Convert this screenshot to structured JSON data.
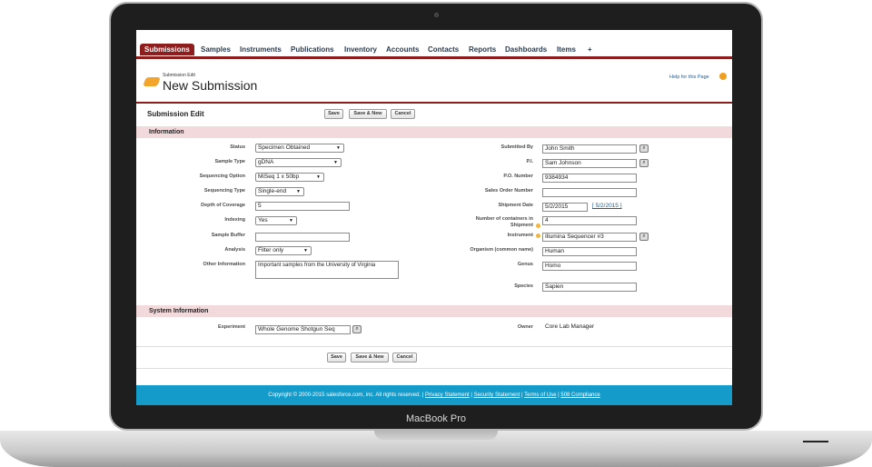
{
  "device": {
    "brand": "MacBook Pro"
  },
  "tabs": [
    "Submissions",
    "Samples",
    "Instruments",
    "Publications",
    "Inventory",
    "Accounts",
    "Contacts",
    "Reports",
    "Dashboards",
    "Items",
    "+"
  ],
  "header": {
    "subtitle": "Submission Edit",
    "title": "New Submission",
    "help": "Help for this Page"
  },
  "edit_title": "Submission Edit",
  "buttons": {
    "save": "Save",
    "save_new": "Save & New",
    "cancel": "Cancel"
  },
  "sections": {
    "information": "Information",
    "system": "System Information"
  },
  "left_fields": {
    "status": {
      "label": "Status",
      "value": "Specimen Obtained"
    },
    "sample_type": {
      "label": "Sample Type",
      "value": "gDNA"
    },
    "sequencing_option": {
      "label": "Sequencing Option",
      "value": "MiSeq 1 x 50bp"
    },
    "sequencing_type": {
      "label": "Sequencing Type",
      "value": "Single-end"
    },
    "depth": {
      "label": "Depth of Coverage",
      "value": "5"
    },
    "indexing": {
      "label": "Indexing",
      "value": "Yes"
    },
    "buffer": {
      "label": "Sample Buffer",
      "value": ""
    },
    "analysis": {
      "label": "Analysis",
      "value": "Filter only"
    },
    "other": {
      "label": "Other Information",
      "value": "Important samples from the University of Virginia"
    }
  },
  "right_fields": {
    "submitted_by": {
      "label": "Submitted By",
      "value": "John Smith"
    },
    "pi": {
      "label": "P.I.",
      "value": "Sam Johnson"
    },
    "po": {
      "label": "P.O. Number",
      "value": "9384934"
    },
    "so": {
      "label": "Sales Order Number",
      "value": ""
    },
    "ship_date": {
      "label": "Shipment Date",
      "value": "5/2/2015",
      "link": "[ 5/2/2015 ]"
    },
    "containers": {
      "label1": "Number of containers in",
      "label2": "Shipment",
      "value": "4"
    },
    "instrument": {
      "label": "Instrument",
      "value": "Illumina Sequencer #3"
    },
    "organism": {
      "label": "Organism (common name)",
      "value": "Human"
    },
    "genus": {
      "label": "Genus",
      "value": "Homo"
    },
    "species": {
      "label": "Species",
      "value": "Sapien"
    }
  },
  "system": {
    "experiment": {
      "label": "Experiment",
      "value": "Whole Genome Shotgun Seq"
    },
    "owner": {
      "label": "Owner",
      "value": "Core Lab Manager"
    }
  },
  "footer": {
    "copyright": "Copyright © 2000-2015 salesforce.com, inc. All rights reserved. |",
    "links": [
      "Privacy Statement",
      "Security Statement",
      "Terms of Use",
      "508 Compliance"
    ]
  }
}
